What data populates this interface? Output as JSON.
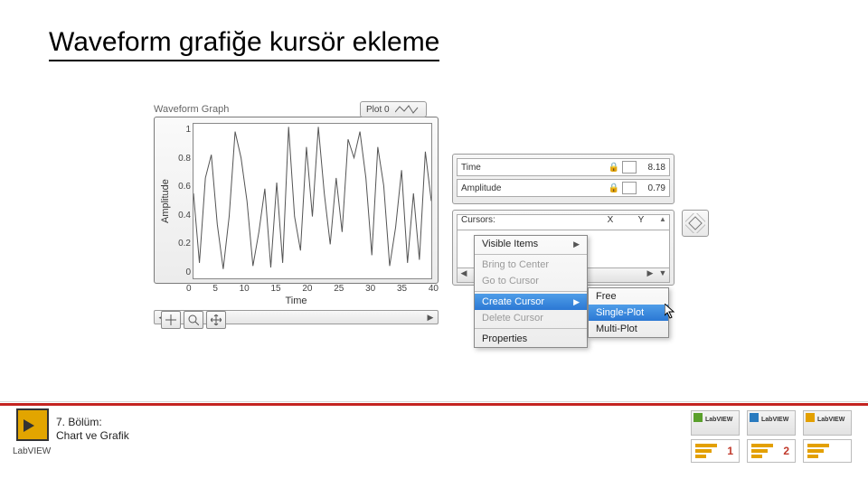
{
  "title": "Waveform grafiğe kursör ekleme",
  "graph": {
    "caption": "Waveform Graph",
    "legend_label": "Plot 0",
    "y_label": "Amplitude",
    "x_label": "Time",
    "y_ticks": [
      "1",
      "0.8",
      "0.6",
      "0.4",
      "0.2",
      "0"
    ],
    "x_ticks": [
      "0",
      "5",
      "10",
      "15",
      "20",
      "25",
      "30",
      "35",
      "40"
    ]
  },
  "tool_icons": {
    "crosshair": "crosshair",
    "zoom": "zoom",
    "hand": "hand"
  },
  "info_rows": {
    "time": {
      "label": "Time",
      "value": "8.18"
    },
    "amp": {
      "label": "Amplitude",
      "value": "0.79"
    }
  },
  "cursors_header": {
    "title": "Cursors:",
    "col_x": "X",
    "col_y": "Y"
  },
  "context_menu": {
    "visible_items": "Visible Items",
    "bring_to_center": "Bring to Center",
    "go_to_cursor": "Go to Cursor",
    "create_cursor": "Create Cursor",
    "delete_cursor": "Delete Cursor",
    "properties": "Properties"
  },
  "submenu": {
    "free": "Free",
    "single_plot": "Single-Plot",
    "multi_plot": "Multi-Plot"
  },
  "chart_data": {
    "type": "line",
    "title": "Waveform Graph",
    "xlabel": "Time",
    "ylabel": "Amplitude",
    "xlim": [
      0,
      40
    ],
    "ylim": [
      0,
      1
    ],
    "x": [
      0,
      1,
      2,
      3,
      4,
      5,
      6,
      7,
      8,
      9,
      10,
      11,
      12,
      13,
      14,
      15,
      16,
      17,
      18,
      19,
      20,
      21,
      22,
      23,
      24,
      25,
      26,
      27,
      28,
      29,
      30,
      31,
      32,
      33,
      34,
      35,
      36,
      37,
      38,
      39,
      40
    ],
    "values": [
      0.55,
      0.1,
      0.65,
      0.8,
      0.35,
      0.06,
      0.4,
      0.95,
      0.78,
      0.5,
      0.08,
      0.3,
      0.58,
      0.07,
      0.62,
      0.1,
      0.98,
      0.4,
      0.18,
      0.85,
      0.4,
      0.98,
      0.55,
      0.22,
      0.65,
      0.3,
      0.9,
      0.78,
      0.95,
      0.65,
      0.15,
      0.85,
      0.6,
      0.08,
      0.33,
      0.7,
      0.1,
      0.55,
      0.12,
      0.82,
      0.5
    ]
  },
  "footer": {
    "chapter_line1": "7. Bölüm:",
    "chapter_line2": "Chart ve Grafik",
    "labview": "LabVIEW",
    "badges": {
      "b1": "LabVIEW",
      "b2": "LabVIEW",
      "b3": "LabVIEW",
      "n1": "1",
      "n2": "2",
      "n3": ""
    }
  }
}
